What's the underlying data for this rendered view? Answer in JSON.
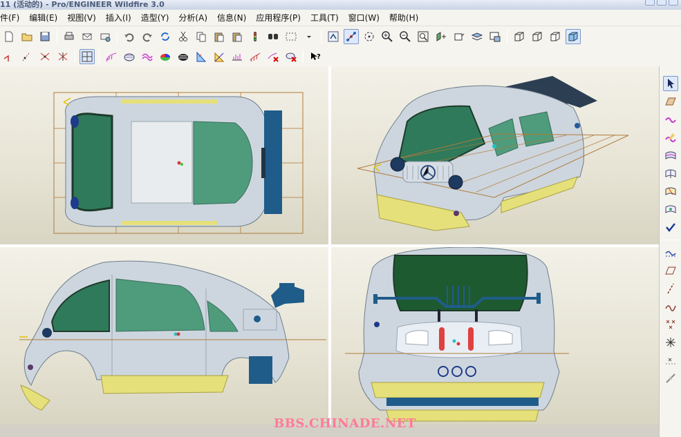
{
  "window": {
    "title": "11 (活动的) - Pro/ENGINEER Wildfire 3.0"
  },
  "menu": [
    "件(F)",
    "编辑(E)",
    "视图(V)",
    "插入(I)",
    "造型(Y)",
    "分析(A)",
    "信息(N)",
    "应用程序(P)",
    "工具(T)",
    "窗口(W)",
    "帮助(H)"
  ],
  "toolbar1": [
    "new-file-icon",
    "open-folder-icon",
    "save-icon",
    "print-icon",
    "send-mail-icon",
    "mail-recipient-icon",
    "undo-icon",
    "redo-icon",
    "regenerate-icon",
    "cut-icon",
    "copy-icon",
    "paste-icon",
    "paste-special-icon",
    "model-player-icon",
    "find-icon",
    "select-box-icon",
    "select-dropdown-icon",
    "repaint-icon",
    "spin-center-icon",
    "orient-mode-icon",
    "zoom-in-icon",
    "zoom-out-icon",
    "refit-icon",
    "reorient-icon",
    "saved-views-icon",
    "layers-icon",
    "view-manager-icon",
    "wireframe-icon",
    "hidden-line-icon",
    "no-hidden-icon",
    "shading-icon"
  ],
  "toolbar2": [
    "curve-tool-icon",
    "datum-point-icon",
    "datum-axis-icon",
    "coordinate-system-icon",
    "grid-toggle-icon",
    "curvature-analysis-icon",
    "section-analysis-icon",
    "offset-analysis-icon",
    "draft-analysis-icon",
    "reflection-analysis-icon",
    "slope-analysis-icon",
    "dihedral-analysis-icon",
    "curvature-plot-icon",
    "deviation-analysis-icon",
    "delete-curve-analysis-icon",
    "delete-surface-analysis-icon",
    "whats-this-icon"
  ],
  "right_tools": [
    "select-arrow-icon",
    "set-active-plane-icon",
    "create-curve-icon",
    "curve-from-surface-icon",
    "boundary-surface-icon",
    "connect-surface-icon",
    "trim-surface-icon",
    "surface-edit-icon",
    "done-check-icon",
    "curve-on-surface-icon",
    "internal-plane-icon",
    "dropped-curve-icon",
    "cos-curve-icon",
    "datum-point-x-icon",
    "datum-point-star-icon",
    "sketched-point-icon",
    "offset-tool-icon"
  ],
  "viewports": [
    "top-view",
    "isometric-view",
    "side-view",
    "rear-view"
  ],
  "watermark": "BBS.CHINADE.NET",
  "colors": {
    "body": "#cdd6de",
    "glass": "#2f7a5a",
    "bumper": "#e6e07a",
    "datum": "#b07a3a",
    "accent": "#1f5c8a"
  }
}
